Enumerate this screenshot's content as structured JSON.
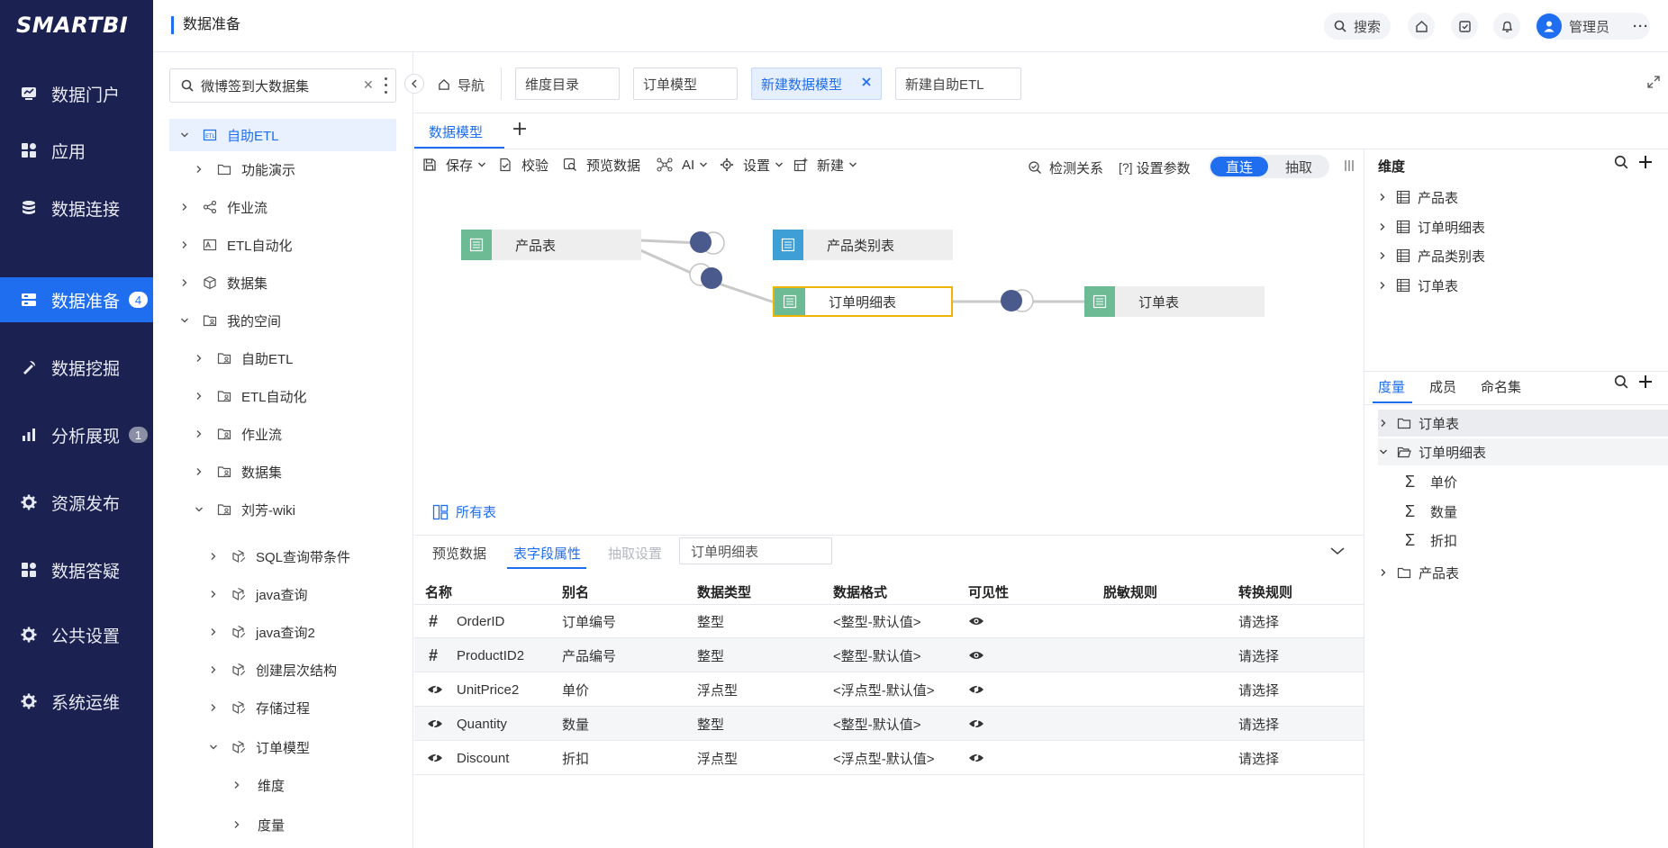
{
  "nav": {
    "logo": "SMARTBI",
    "items": [
      {
        "label": "数据门户",
        "icon": "monitor-icon",
        "badge": ""
      },
      {
        "label": "应用",
        "icon": "apps-icon",
        "badge": ""
      },
      {
        "label": "数据连接",
        "icon": "database-icon",
        "badge": ""
      },
      {
        "label": "数据准备",
        "icon": "data-prep-icon",
        "badge": "4",
        "active": true
      },
      {
        "label": "数据挖掘",
        "icon": "pickaxe-icon",
        "badge": ""
      },
      {
        "label": "分析展现",
        "icon": "bar-chart-icon",
        "badge": "1"
      },
      {
        "label": "资源发布",
        "icon": "gear-icon",
        "badge": ""
      },
      {
        "label": "数据答疑",
        "icon": "apps-icon",
        "badge": ""
      },
      {
        "label": "公共设置",
        "icon": "gear-icon",
        "badge": ""
      },
      {
        "label": "系统运维",
        "icon": "gear-icon",
        "badge": ""
      }
    ]
  },
  "header": {
    "title": "数据准备",
    "search_label": "搜索",
    "user_name": "管理员"
  },
  "tree": {
    "search_value": "微博签到大数据集",
    "items": [
      {
        "label": "自助ETL",
        "icon": "etl-icon",
        "chevron": "down"
      },
      {
        "label": "功能演示",
        "icon": "folder-icon",
        "chevron": "right"
      },
      {
        "label": "作业流",
        "icon": "workflow-icon",
        "chevron": "right"
      },
      {
        "label": "ETL自动化",
        "icon": "etl-auto-icon",
        "chevron": "right"
      },
      {
        "label": "数据集",
        "icon": "cube-icon",
        "chevron": "right"
      },
      {
        "label": "我的空间",
        "icon": "user-folder-icon",
        "chevron": "down"
      },
      {
        "label": "自助ETL",
        "icon": "user-folder-icon",
        "chevron": "right"
      },
      {
        "label": "ETL自动化",
        "icon": "user-folder-icon",
        "chevron": "right"
      },
      {
        "label": "作业流",
        "icon": "user-folder-icon",
        "chevron": "right"
      },
      {
        "label": "数据集",
        "icon": "user-folder-icon",
        "chevron": "right"
      },
      {
        "label": "刘芳-wiki",
        "icon": "user-folder-icon",
        "chevron": "down"
      },
      {
        "label": "SQL查询带条件",
        "icon": "cube-edit-icon",
        "chevron": "right"
      },
      {
        "label": "java查询",
        "icon": "cube-edit-icon",
        "chevron": "right"
      },
      {
        "label": "java查询2",
        "icon": "cube-edit-icon",
        "chevron": "right"
      },
      {
        "label": "创建层次结构",
        "icon": "cube-edit-icon",
        "chevron": "right"
      },
      {
        "label": "存储过程",
        "icon": "cube-edit-icon",
        "chevron": "right"
      },
      {
        "label": "订单模型",
        "icon": "cube-edit-icon",
        "chevron": "down"
      },
      {
        "label": "维度",
        "icon": "",
        "chevron": "right"
      },
      {
        "label": "度量",
        "icon": "",
        "chevron": "right"
      }
    ]
  },
  "tabs": {
    "nav_label": "导航",
    "items": [
      "维度目录",
      "订单模型",
      "新建数据模型",
      "新建自助ETL"
    ]
  },
  "model": {
    "tab_label": "数据模型",
    "toolbar": {
      "save": "保存",
      "validate": "校验",
      "preview": "预览数据",
      "ai": "AI",
      "settings": "设置",
      "new": "新建",
      "detect": "检测关系",
      "params_prefix": "[?]",
      "params": "设置参数",
      "direct": "直连",
      "extract": "抽取"
    },
    "nodes": [
      "产品表",
      "产品类别表",
      "订单明细表",
      "订单表"
    ],
    "all_tables": "所有表"
  },
  "bottom": {
    "tabs": [
      "预览数据",
      "表字段属性",
      "抽取设置"
    ],
    "table_name": "订单明细表",
    "columns": [
      "名称",
      "别名",
      "数据类型",
      "数据格式",
      "可见性",
      "脱敏规则",
      "转换规则"
    ],
    "rows": [
      {
        "icon": "hash-icon",
        "name": "OrderID",
        "alias": "订单编号",
        "type": "整型",
        "format": "<整型-默认值>",
        "visibility": "visible-icon",
        "mask": "",
        "convert": "请选择"
      },
      {
        "icon": "hash-icon",
        "name": "ProductID2",
        "alias": "产品编号",
        "type": "整型",
        "format": "<整型-默认值>",
        "visibility": "visible-icon",
        "mask": "",
        "convert": "请选择"
      },
      {
        "icon": "hidden-icon",
        "name": "UnitPrice2",
        "alias": "单价",
        "type": "浮点型",
        "format": "<浮点型-默认值>",
        "visibility": "hidden-icon",
        "mask": "",
        "convert": "请选择"
      },
      {
        "icon": "hidden-icon",
        "name": "Quantity",
        "alias": "数量",
        "type": "整型",
        "format": "<整型-默认值>",
        "visibility": "hidden-icon",
        "mask": "",
        "convert": "请选择"
      },
      {
        "icon": "hidden-icon",
        "name": "Discount",
        "alias": "折扣",
        "type": "浮点型",
        "format": "<浮点型-默认值>",
        "visibility": "hidden-icon",
        "mask": "",
        "convert": "请选择"
      }
    ]
  },
  "right": {
    "dim_title": "维度",
    "dims": [
      "产品表",
      "订单明细表",
      "产品类别表",
      "订单表"
    ],
    "measure_tabs": [
      "度量",
      "成员",
      "命名集"
    ],
    "measures": [
      {
        "label": "订单表",
        "kind": "folder",
        "chevron": "right"
      },
      {
        "label": "订单明细表",
        "kind": "folder-open",
        "chevron": "down"
      },
      {
        "label": "单价",
        "kind": "sigma",
        "chevron": ""
      },
      {
        "label": "数量",
        "kind": "sigma",
        "chevron": ""
      },
      {
        "label": "折扣",
        "kind": "sigma",
        "chevron": ""
      },
      {
        "label": "产品表",
        "kind": "folder",
        "chevron": "right"
      }
    ]
  },
  "colors": {
    "nav_bg": "#1b2150",
    "accent": "#1f6eef",
    "node_blue": "#3d9fd6",
    "node_green": "#6dbb94",
    "join": "#4a5a8c"
  }
}
